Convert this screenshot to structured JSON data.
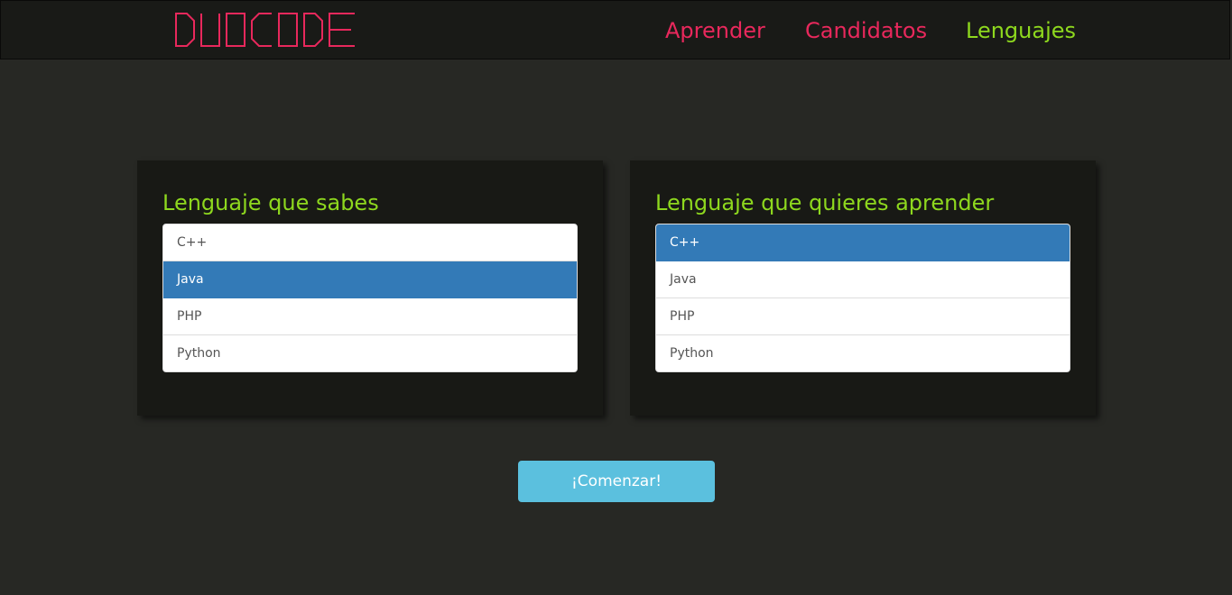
{
  "colors": {
    "brand_pink": "#e8285c",
    "accent_green": "#8ed81e",
    "selected_blue": "#337ab7",
    "button_cyan": "#5bc0de"
  },
  "header": {
    "logo_text": "DUOCODE",
    "nav": [
      {
        "label": "Aprender",
        "color": "#e8285c"
      },
      {
        "label": "Candidatos",
        "color": "#e8285c"
      },
      {
        "label": "Lenguajes",
        "color": "#8ed81e"
      }
    ]
  },
  "known_language": {
    "title": "Lenguaje que sabes",
    "items": [
      {
        "label": "C++",
        "selected": false
      },
      {
        "label": "Java",
        "selected": true
      },
      {
        "label": "PHP",
        "selected": false
      },
      {
        "label": "Python",
        "selected": false
      }
    ]
  },
  "target_language": {
    "title": "Lenguaje que quieres aprender",
    "items": [
      {
        "label": "C++",
        "selected": true
      },
      {
        "label": "Java",
        "selected": false
      },
      {
        "label": "PHP",
        "selected": false
      },
      {
        "label": "Python",
        "selected": false
      }
    ]
  },
  "start_button": {
    "label": "¡Comenzar!"
  }
}
